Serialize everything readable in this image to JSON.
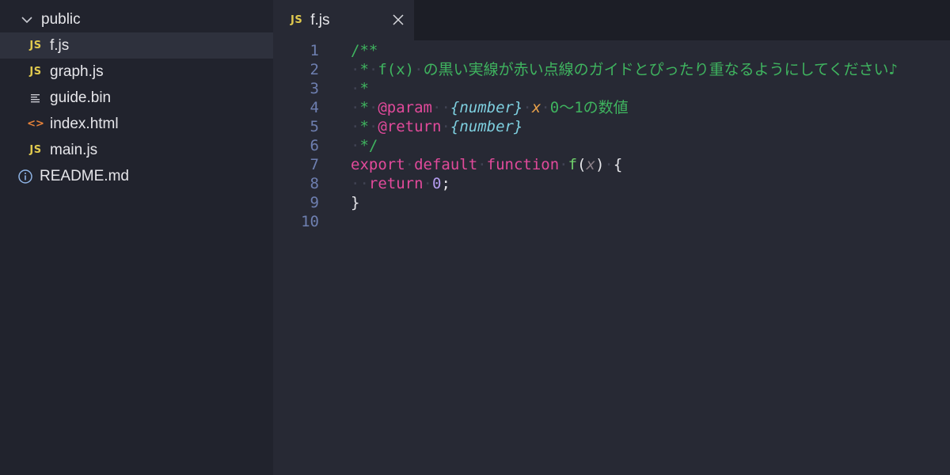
{
  "sidebar": {
    "folder": {
      "name": "public"
    },
    "files": [
      {
        "name": "f.js",
        "icon": "js-icon",
        "icon_text": "JS"
      },
      {
        "name": "graph.js",
        "icon": "js-icon",
        "icon_text": "JS"
      },
      {
        "name": "guide.bin",
        "icon": "binary-file-icon"
      },
      {
        "name": "index.html",
        "icon": "html-icon",
        "icon_text": "<>"
      },
      {
        "name": "main.js",
        "icon": "js-icon",
        "icon_text": "JS"
      }
    ],
    "root_files": [
      {
        "name": "README.md",
        "icon": "info-icon"
      }
    ],
    "selected": "f.js"
  },
  "tab": {
    "label": "f.js",
    "icon_text": "JS"
  },
  "editor": {
    "line_numbers": [
      "1",
      "2",
      "3",
      "4",
      "5",
      "6",
      "7",
      "8",
      "9",
      "10"
    ],
    "lines": [
      "/**",
      " * f(x) の黒い実線が赤い点線のガイドとぴったり重なるようにしてください♪",
      " *",
      " * @param  {number} x 0〜1の数値",
      " * @return {number}",
      " */",
      "export default function f(x) {",
      "  return 0;",
      "}",
      ""
    ]
  },
  "colors": {
    "sidebar_bg": "#21232d",
    "editor_bg": "#272934",
    "comment": "#3fb45f",
    "keyword": "#e24a9b",
    "type": "#7ecfdf",
    "param": "#e8a14a",
    "function": "#6fd16b",
    "number": "#b49cf0",
    "js_icon": "#e0c94e"
  }
}
